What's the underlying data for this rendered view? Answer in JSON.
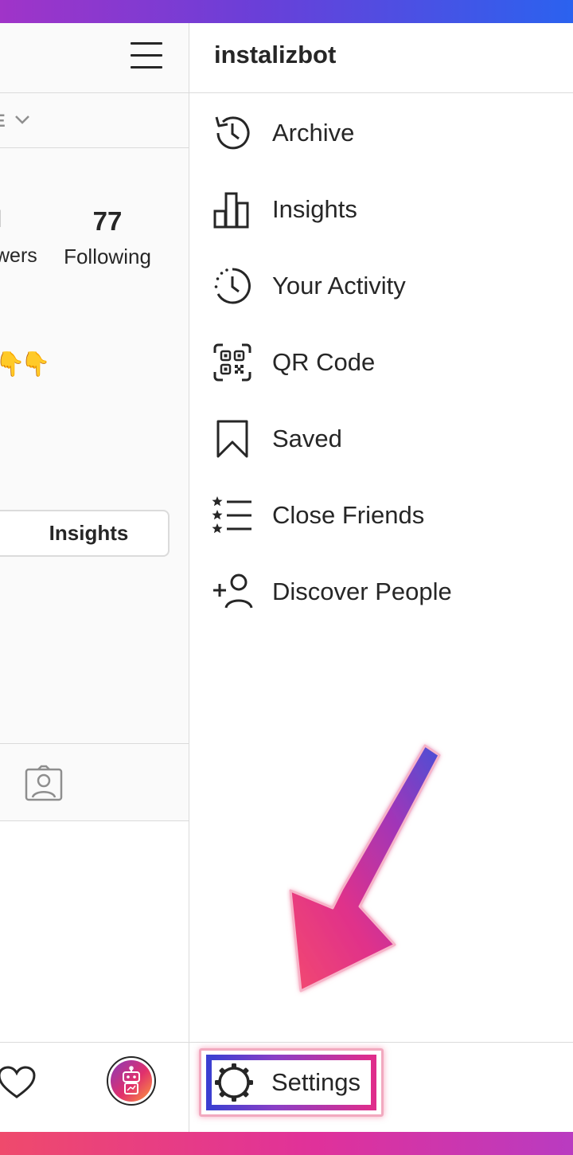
{
  "left_pane": {
    "tab_partial": "E",
    "stats": {
      "partial_num": "l",
      "partial_label": "wers",
      "following_count": "77",
      "following_label": "Following"
    },
    "bio_emoji": [
      "👇",
      "👇"
    ],
    "insights_button": "Insights",
    "icons": [
      "menu-icon",
      "chevron-down-icon",
      "tagged-photos-icon",
      "heart-icon",
      "robot-avatar-icon"
    ]
  },
  "drawer": {
    "username": "instalizbot",
    "menu": [
      {
        "label": "Archive",
        "icon": "archive-icon"
      },
      {
        "label": "Insights",
        "icon": "insights-icon"
      },
      {
        "label": "Your Activity",
        "icon": "activity-icon"
      },
      {
        "label": "QR Code",
        "icon": "qr-code-icon"
      },
      {
        "label": "Saved",
        "icon": "saved-icon"
      },
      {
        "label": "Close Friends",
        "icon": "close-friends-icon"
      },
      {
        "label": "Discover People",
        "icon": "discover-people-icon"
      }
    ],
    "settings_label": "Settings",
    "settings_icon": "gear-icon"
  },
  "colors": {
    "top_gradient": [
      "#a034c8",
      "#2b62ef"
    ],
    "bottom_gradient": [
      "#ef4a6c",
      "#b93bc1"
    ],
    "highlight_arrow": [
      "#4a4fd6",
      "#e0318a",
      "#f34a6f"
    ],
    "text": "#262626",
    "divider": "#dbdbdb"
  }
}
